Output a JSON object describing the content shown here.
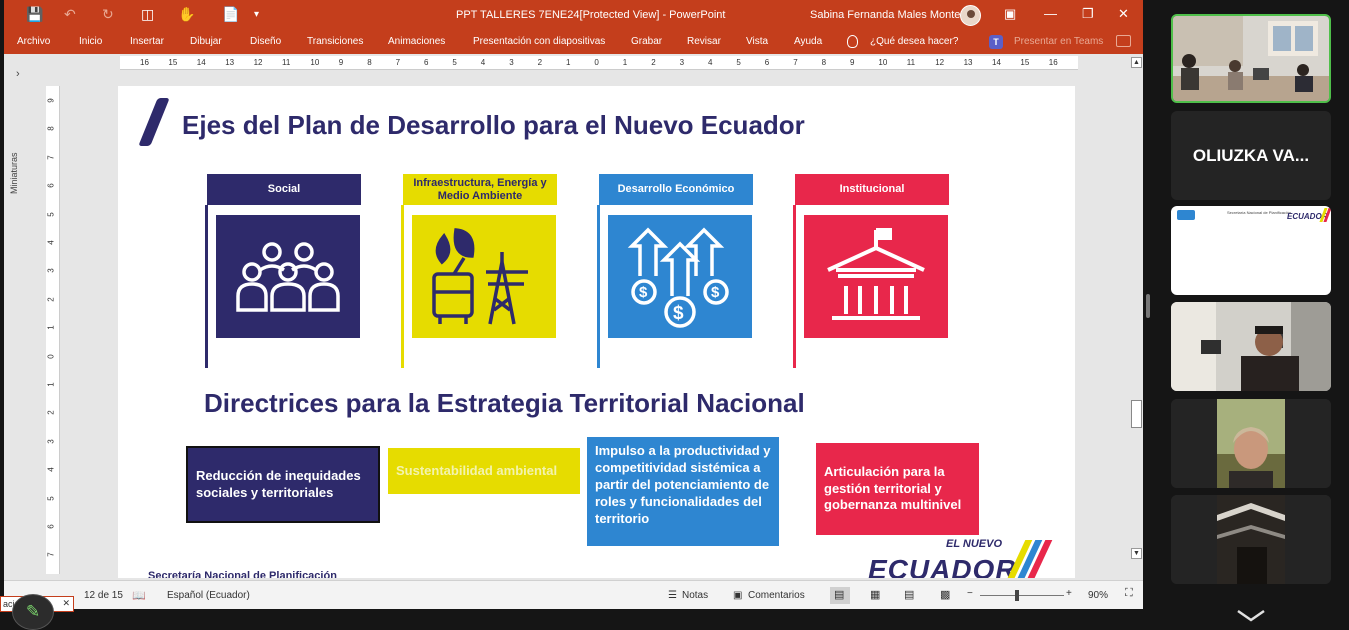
{
  "powerpoint": {
    "window_title": "PPT  TALLERES 7ENE24[Protected View]  -  PowerPoint",
    "user_name": "Sabina Fernanda Males Montero",
    "ribbon_tabs": [
      "Archivo",
      "Inicio",
      "Insertar",
      "Dibujar",
      "Diseño",
      "Transiciones",
      "Animaciones",
      "Presentación con diapositivas",
      "Grabar",
      "Revisar",
      "Vista",
      "Ayuda"
    ],
    "tell_me": "¿Qué desea hacer?",
    "present_in_teams": "Presentar en Teams",
    "thumbnails_label": "Miniaturas",
    "ruler_labels": [
      "16",
      "15",
      "14",
      "13",
      "12",
      "11",
      "10",
      "9",
      "8",
      "7",
      "6",
      "5",
      "4",
      "3",
      "2",
      "1",
      "0",
      "1",
      "2",
      "3",
      "4",
      "5",
      "6",
      "7",
      "8",
      "9",
      "10",
      "11",
      "12",
      "13",
      "14",
      "15",
      "16"
    ],
    "vruler_labels": [
      "9",
      "8",
      "7",
      "6",
      "5",
      "4",
      "3",
      "2",
      "1",
      "0",
      "1",
      "2",
      "3",
      "4",
      "5",
      "6",
      "7"
    ]
  },
  "slide": {
    "title": "Ejes del Plan de Desarrollo para el Nuevo Ecuador",
    "axes": [
      {
        "label": "Social",
        "color": "#2e2a6b",
        "icon": "people-group-icon"
      },
      {
        "label": "Infraestructura, Energía y Medio Ambiente",
        "color": "#e6dc00",
        "icon": "bus-tower-plant-icon"
      },
      {
        "label": "Desarrollo Económico",
        "color": "#2e86d1",
        "icon": "money-growth-icon"
      },
      {
        "label": "Institucional",
        "color": "#e8274b",
        "icon": "government-building-icon"
      }
    ],
    "subtitle": "Directrices para la Estrategia Territorial Nacional",
    "directives": [
      {
        "label": "Reducción de inequidades sociales y territoriales",
        "color": "#2e2a6b"
      },
      {
        "label": "Sustentabilidad ambiental",
        "color": "#e6dc00"
      },
      {
        "label": "Impulso a la productividad y competitividad sistémica a partir del potenciamiento de roles y funcionalidades del territorio",
        "color": "#2e86d1"
      },
      {
        "label": "Articulación para la gestión territorial y gobernanza multinivel",
        "color": "#e8274b"
      }
    ],
    "footer_text": "Secretaría Nacional de Planificación",
    "logo_top": "EL NUEVO",
    "logo_main": "ECUADOR"
  },
  "status_bar": {
    "slide_counter": "12 de 15",
    "language": "Español (Ecuador)",
    "notes": "Notas",
    "comments": "Comentarios",
    "zoom": "90%",
    "zoom_minus": "−",
    "zoom_plus": "+"
  },
  "pen_box_text": "acio",
  "video_panel": {
    "participant_name": "OLIUZKA VA...",
    "shared_slide_title": "Secretaría Nacional de Planificación",
    "shared_logo": "ECUADOR"
  }
}
